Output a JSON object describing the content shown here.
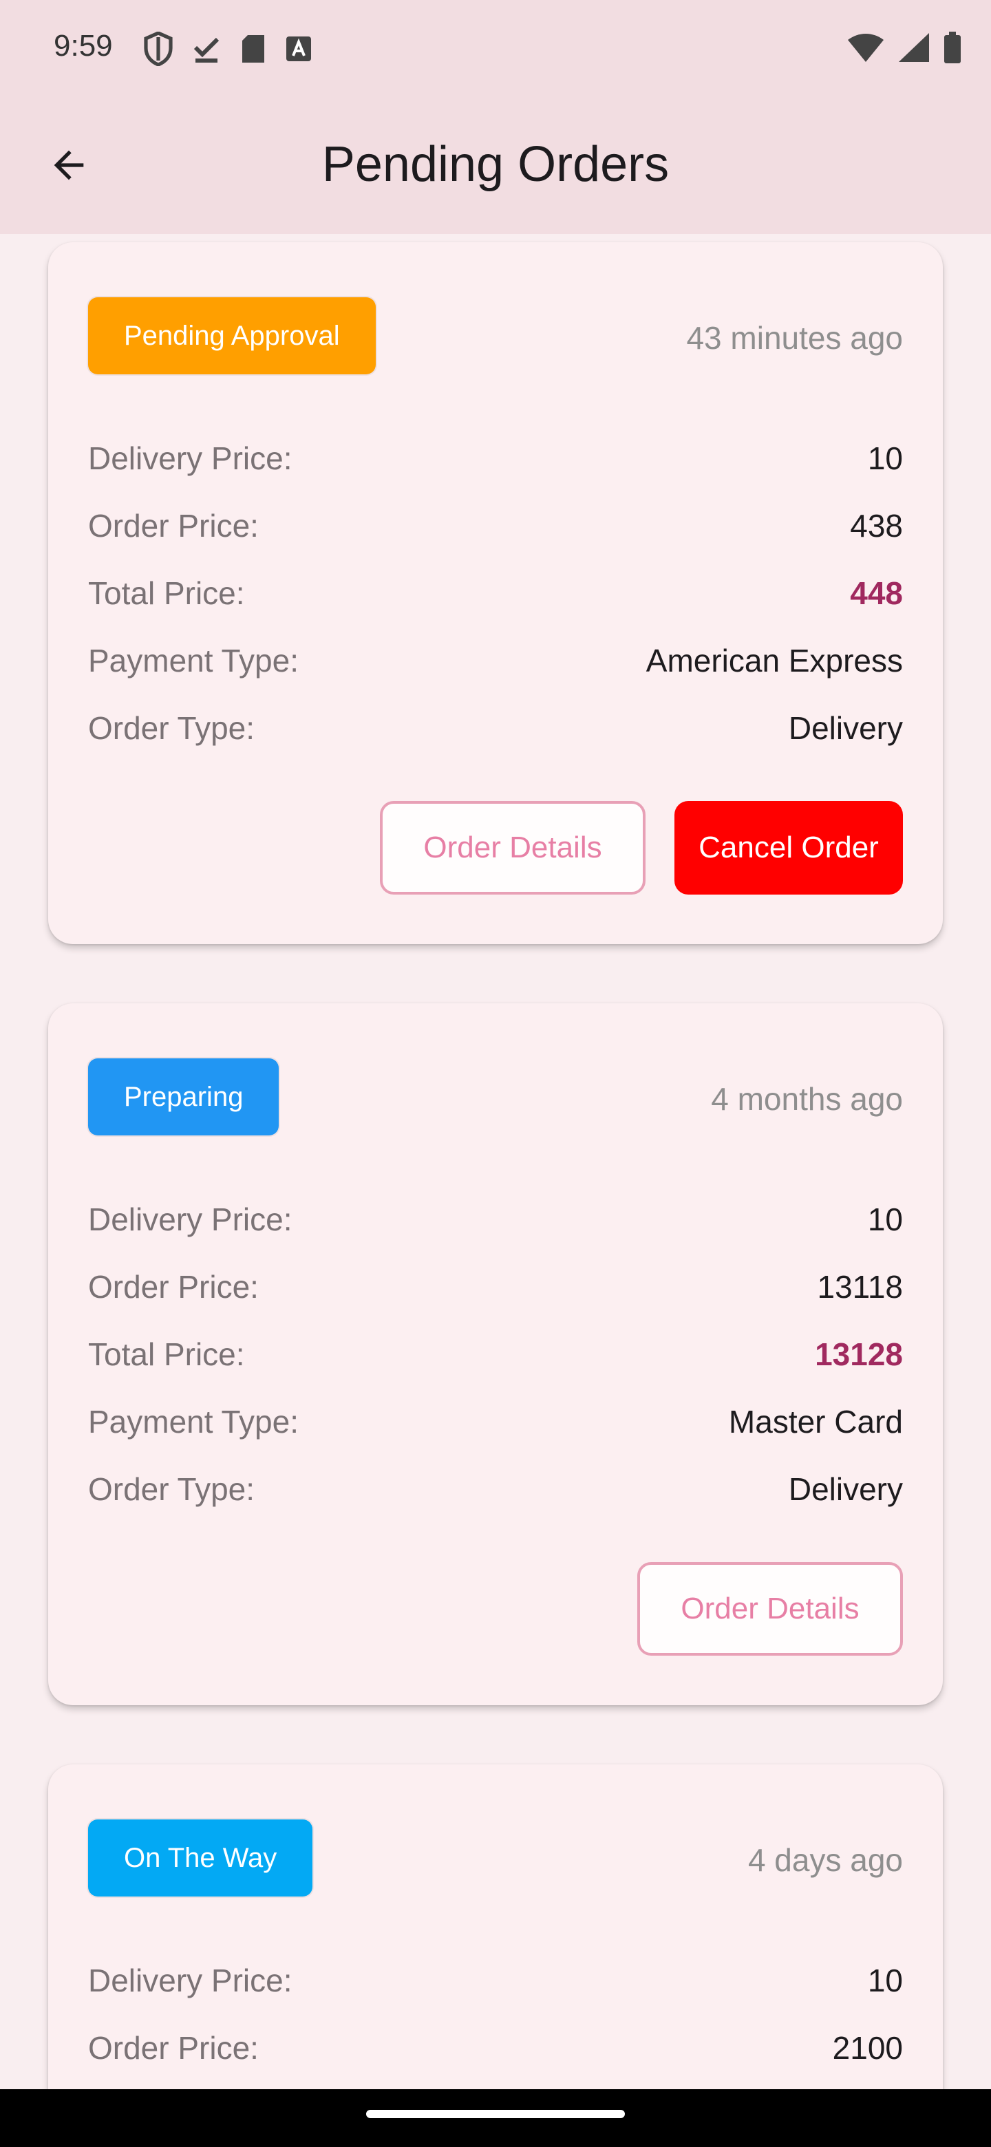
{
  "status_bar": {
    "time": "9:59"
  },
  "app_bar": {
    "title": "Pending Orders"
  },
  "labels": {
    "delivery_price": "Delivery Price:",
    "order_price": "Order Price:",
    "total_price": "Total Price:",
    "payment_type": "Payment Type:",
    "order_type": "Order Type:"
  },
  "orders": [
    {
      "status": "Pending Approval",
      "status_color": "#FF9F00",
      "time_ago": "43 minutes ago",
      "delivery_price": "10",
      "order_price": "438",
      "total_price": "448",
      "payment_type": "American Express",
      "order_type": "Delivery",
      "details_label": "Order Details",
      "cancel_label": "Cancel Order"
    },
    {
      "status": "Preparing",
      "status_color": "#2196F3",
      "time_ago": "4 months ago",
      "delivery_price": "10",
      "order_price": "13118",
      "total_price": "13128",
      "payment_type": "Master Card",
      "order_type": "Delivery",
      "details_label": "Order Details"
    },
    {
      "status": "On The Way",
      "status_color": "#03A9F4",
      "time_ago": "4 days ago",
      "delivery_price": "10",
      "order_price": "2100"
    }
  ]
}
